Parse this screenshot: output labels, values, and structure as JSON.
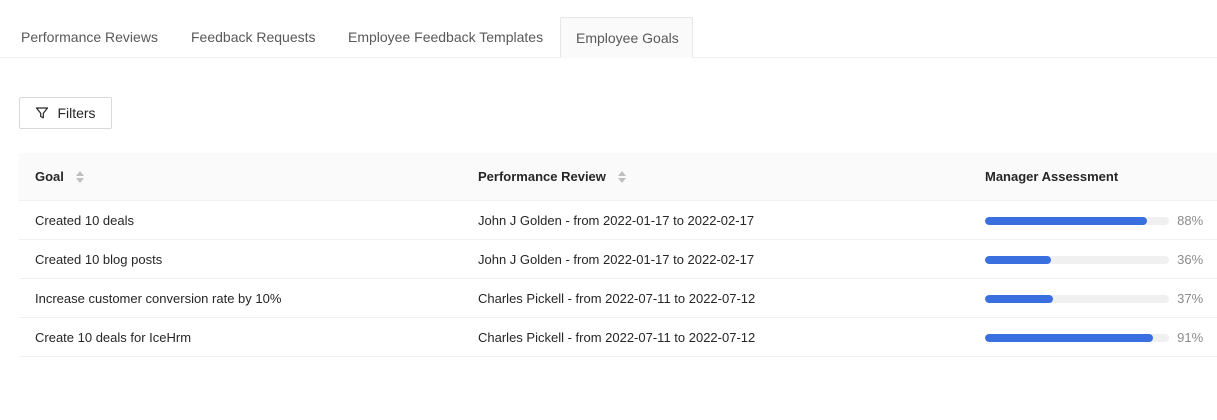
{
  "tabs": [
    {
      "label": "Performance Reviews",
      "active": false
    },
    {
      "label": "Feedback Requests",
      "active": false
    },
    {
      "label": "Employee Feedback Templates",
      "active": false
    },
    {
      "label": "Employee Goals",
      "active": true
    }
  ],
  "toolbar": {
    "filters_label": "Filters",
    "filters_icon": "filter-icon"
  },
  "table": {
    "columns": [
      {
        "label": "Goal",
        "sortable": true
      },
      {
        "label": "Performance Review",
        "sortable": true
      },
      {
        "label": "Manager Assessment",
        "sortable": false
      }
    ],
    "rows": [
      {
        "goal": "Created 10 deals",
        "review": "John J Golden - from 2022-01-17 to 2022-02-17",
        "assessment": 88,
        "assessment_label": "88%"
      },
      {
        "goal": "Created 10 blog posts",
        "review": "John J Golden - from 2022-01-17 to 2022-02-17",
        "assessment": 36,
        "assessment_label": "36%"
      },
      {
        "goal": "Increase customer conversion rate by 10%",
        "review": "Charles Pickell - from 2022-07-11 to 2022-07-12",
        "assessment": 37,
        "assessment_label": "37%"
      },
      {
        "goal": "Create 10 deals for IceHrm",
        "review": "Charles Pickell - from 2022-07-11 to 2022-07-12",
        "assessment": 91,
        "assessment_label": "91%"
      }
    ]
  },
  "colors": {
    "accent": "#3a6fe0",
    "track": "#f0f0f0"
  }
}
